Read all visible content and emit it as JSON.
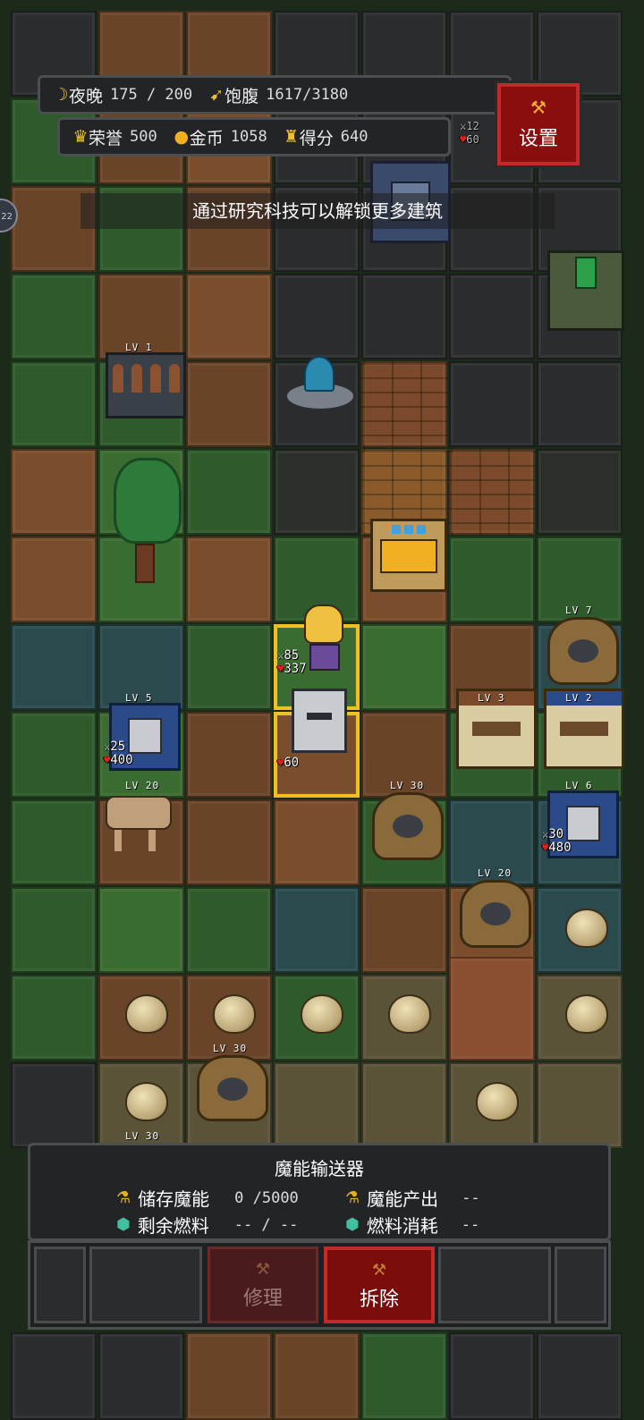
{
  "hud": {
    "time_label": "夜晚",
    "time_value": "175 / 200",
    "food_label": "饱腹",
    "food_value": "1617/3180",
    "honor_label": "荣誉",
    "honor_value": "500",
    "gold_label": "金币",
    "gold_value": "1058",
    "score_label": "得分",
    "score_value": "640"
  },
  "settings_label": "设置",
  "hint": "通过研究科技可以解锁更多建筑",
  "side_badge": "22",
  "units": {
    "hero_atk": "85",
    "hero_hp": "337",
    "turret_hp": "60",
    "left_unit_atk": "25",
    "left_unit_hp": "400",
    "right_unit_atk": "30",
    "right_unit_hp": "480",
    "top_badge_atk": "12",
    "top_badge_hp": "60"
  },
  "levels": {
    "barracks": "LV 1",
    "plant_right": "LV 7",
    "mech_left": "LV 5",
    "house_a": "LV 3",
    "house_b": "LV 2",
    "mech_right": "LV 6",
    "animal": "LV 20",
    "plant_mid": "LV 30",
    "plant_lower": "LV 20",
    "plant_bottom": "LV 30",
    "plant_bottom2": "LV 30"
  },
  "panel": {
    "title": "魔能输送器",
    "stored_label": "储存魔能",
    "stored_value": "0  /5000",
    "output_label": "魔能产出",
    "output_value": "--",
    "fuel_label": "剩余燃料",
    "fuel_value": "-- / --",
    "consume_label": "燃料消耗",
    "consume_value": "--"
  },
  "actions": {
    "repair_label": "修理",
    "demolish_label": "拆除"
  },
  "colors": {
    "highlight": "#f0c020",
    "button_red": "#7a0c0c",
    "gold": "#f0c030"
  }
}
